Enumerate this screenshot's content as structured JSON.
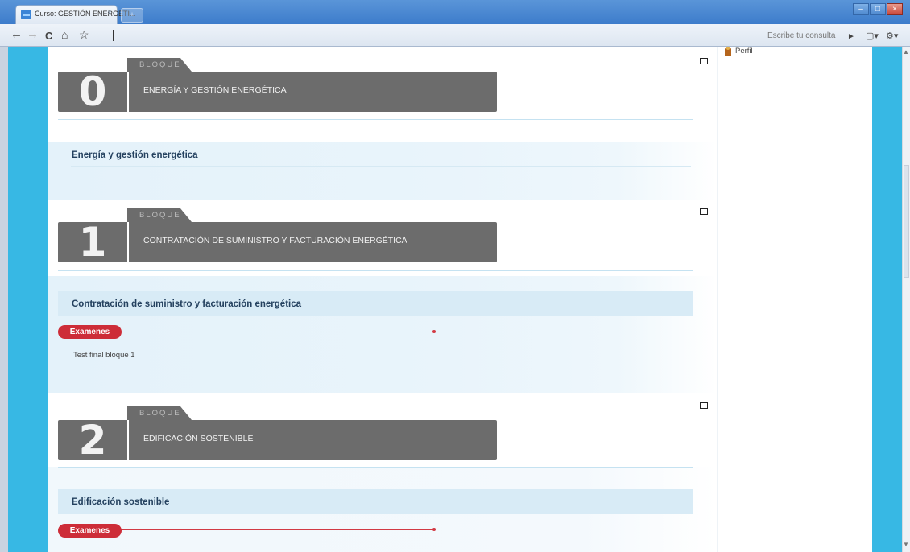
{
  "browser": {
    "tab_title": "Curso: GESTIÓN ENERGÉTI...",
    "tab_close": "×",
    "new_tab": "+",
    "window_buttons": [
      "–",
      "□",
      "×"
    ],
    "nav": {
      "back": "←",
      "forward": "→",
      "reload": "C",
      "home": "⌂",
      "bookmark": "☆"
    },
    "search_hint": "Escribe tu consulta",
    "right_tools": {
      "play": "►",
      "page": "▢▾",
      "wrench": "⚙▾"
    }
  },
  "sidebar": {
    "perfil_label": "Perfil"
  },
  "blocks": [
    {
      "number": "0",
      "label": "BLOQUE",
      "title": "ENERGÍA Y GESTIÓN ENERGÉTICA",
      "topic": "Energía y gestión energética"
    },
    {
      "number": "1",
      "label": "BLOQUE",
      "title": "CONTRATACIÓN DE SUMINISTRO Y FACTURACIÓN ENERGÉTICA",
      "topic": "Contratación de suministro y facturación energética",
      "exam_label": "Examenes",
      "activity": "Test final bloque 1"
    },
    {
      "number": "2",
      "label": "BLOQUE",
      "title": "EDIFICACIÓN SOSTENIBLE",
      "topic": "Edificación sostenible",
      "exam_label": "Examenes"
    }
  ],
  "colors": {
    "accent_blue": "#37b8e4",
    "banner_grey": "#6c6c6c",
    "exam_red": "#cd2d38"
  }
}
